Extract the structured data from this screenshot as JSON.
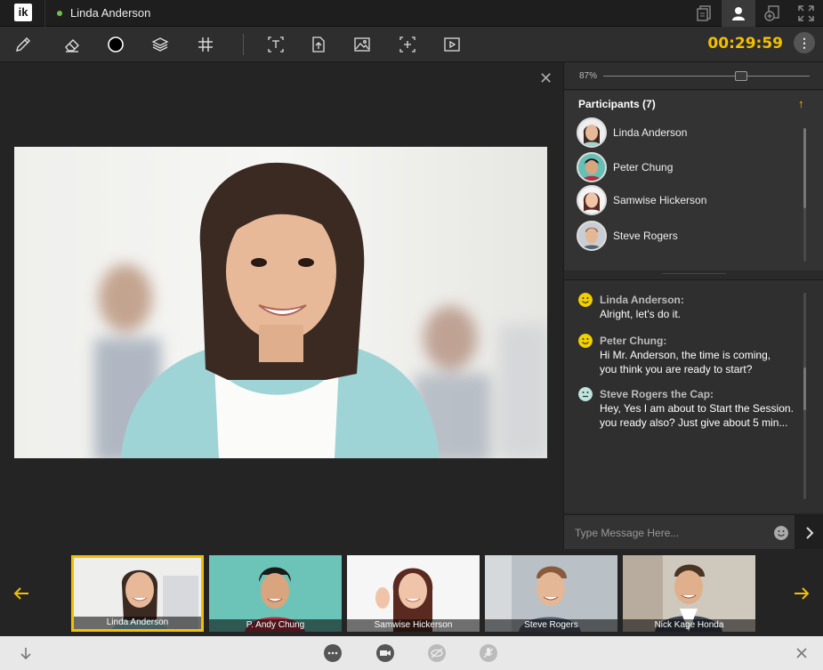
{
  "app": {
    "logo_text": "ik",
    "user_name": "Linda Anderson",
    "user_status_color": "#6fc04a"
  },
  "top_icons": [
    "document-icon",
    "participant-icon",
    "add-content-icon",
    "fullscreen-icon"
  ],
  "toolbar": {
    "tools": [
      "pencil-icon",
      "eraser-icon",
      "color-circle-icon",
      "layers-icon",
      "grid-icon",
      "text-box-icon",
      "upload-file-icon",
      "image-icon",
      "add-frame-icon",
      "video-play-icon"
    ],
    "timer": "00:29:59",
    "more_icon": "more-vertical-icon"
  },
  "stage": {
    "close_icon": "close-icon"
  },
  "panel": {
    "zoom_label": "87%",
    "zoom_fraction": 0.67,
    "participants_title": "Participants (7)",
    "participants": [
      {
        "name": "Linda Anderson"
      },
      {
        "name": "Peter Chung"
      },
      {
        "name": "Samwise Hickerson"
      },
      {
        "name": "Steve Rogers"
      }
    ],
    "chat": [
      {
        "who": "Linda Anderson:",
        "lines": [
          "Alright, let's do it."
        ],
        "emoji": "happy"
      },
      {
        "who": "Peter Chung:",
        "lines": [
          "Hi Mr. Anderson, the time is coming,",
          "you think you are ready to start?"
        ],
        "emoji": "happy"
      },
      {
        "who": "Steve Rogers the Cap:",
        "lines": [
          "Hey, Yes I am about to Start the Session.",
          "you ready also? Just give about 5 min..."
        ],
        "emoji": "neutral"
      }
    ],
    "chat_placeholder": "Type Message Here..."
  },
  "strip": {
    "thumbs": [
      {
        "label": "Linda Anderson",
        "active": true
      },
      {
        "label": "P. Andy Chung",
        "active": false
      },
      {
        "label": "Samwise Hickerson",
        "active": false
      },
      {
        "label": "Steve Rogers",
        "active": false
      },
      {
        "label": "Nick Kage Honda",
        "active": false
      }
    ]
  },
  "bottom_icons": [
    "collapse-down-icon",
    "chat-icon",
    "camera-icon",
    "hide-icon",
    "mute-mic-icon",
    "close-bar-icon"
  ],
  "colors": {
    "accent": "#f2c000",
    "dark_bg": "#242424"
  }
}
